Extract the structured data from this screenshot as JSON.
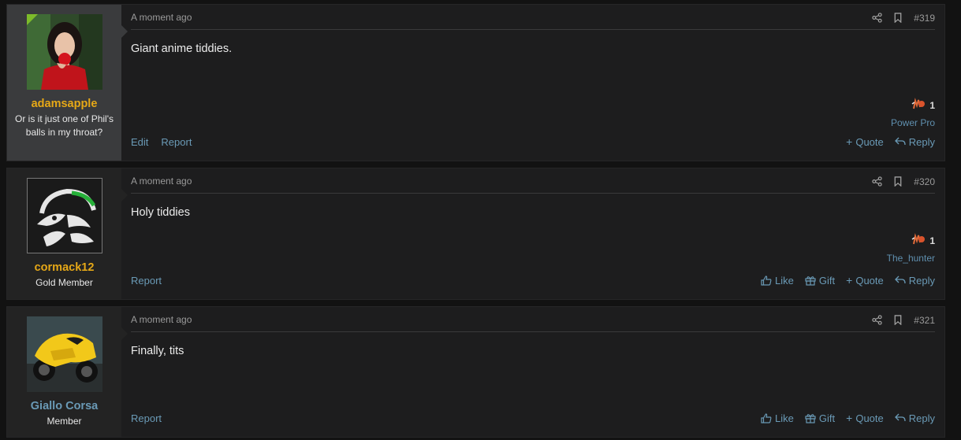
{
  "colors": {
    "page_bg": "#121212",
    "post_bg": "#1d1d1e",
    "username_gold": "#e6a817",
    "username_member": "#6a9ab6",
    "link": "#6a9ab6",
    "online": "#7dbb2a"
  },
  "posts": [
    {
      "username": "adamsapple",
      "user_title": "Or is it just one of Phil's balls in my throat?",
      "timestamp": "A moment ago",
      "post_number": "#319",
      "body": "Giant anime tiddies.",
      "reaction_count": "1",
      "reaction_user": "Power Pro",
      "left_actions": [
        "Edit",
        "Report"
      ],
      "right_actions": [
        "Quote",
        "Reply"
      ]
    },
    {
      "username": "cormack12",
      "user_title": "Gold Member",
      "timestamp": "A moment ago",
      "post_number": "#320",
      "body": "Holy tiddies",
      "reaction_count": "1",
      "reaction_user": "The_hunter",
      "left_actions": [
        "Report"
      ],
      "right_actions": [
        "Like",
        "Gift",
        "Quote",
        "Reply"
      ]
    },
    {
      "username": "Giallo Corsa",
      "user_title": "Member",
      "timestamp": "A moment ago",
      "post_number": "#321",
      "body": "Finally, tits",
      "left_actions": [
        "Report"
      ],
      "right_actions": [
        "Like",
        "Gift",
        "Quote",
        "Reply"
      ]
    }
  ],
  "icons": [
    "share-icon",
    "bookmark-icon",
    "like-icon",
    "gift-icon",
    "quote-plus-icon",
    "reply-icon",
    "reaction-icon"
  ]
}
